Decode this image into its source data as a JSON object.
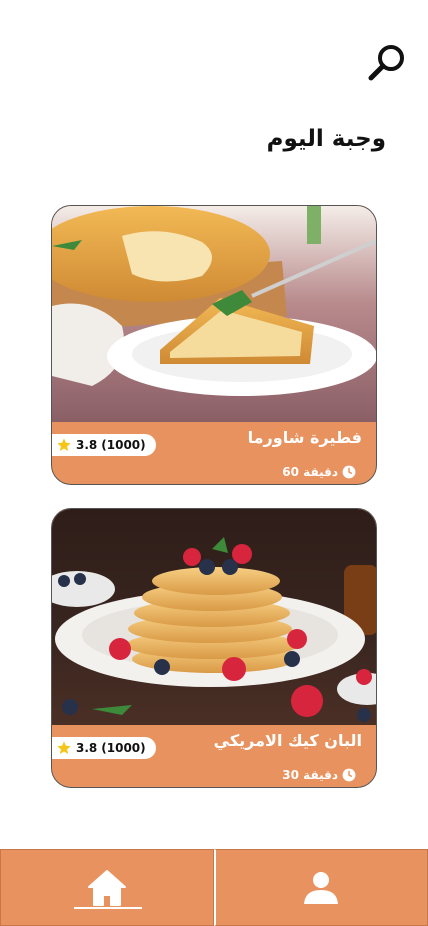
{
  "header": {
    "search_icon": "search-icon",
    "section_title": "وجبة اليوم"
  },
  "meals": [
    {
      "title": "فطيرة شاورما",
      "time": "دقيقة 60",
      "rating": "3.8",
      "reviews": "(1000)",
      "image": "chicken-pie-photo"
    },
    {
      "title": "البان كيك الامريكي",
      "time": "دقيقة 30",
      "rating": "3.8",
      "reviews": "(1000)",
      "image": "pancakes-photo"
    }
  ],
  "nav": {
    "items": [
      {
        "icon": "home-icon",
        "active": true
      },
      {
        "icon": "profile-icon",
        "active": false
      }
    ]
  },
  "colors": {
    "accent": "#e8935f",
    "star": "#f5c518",
    "text": "#111111"
  }
}
